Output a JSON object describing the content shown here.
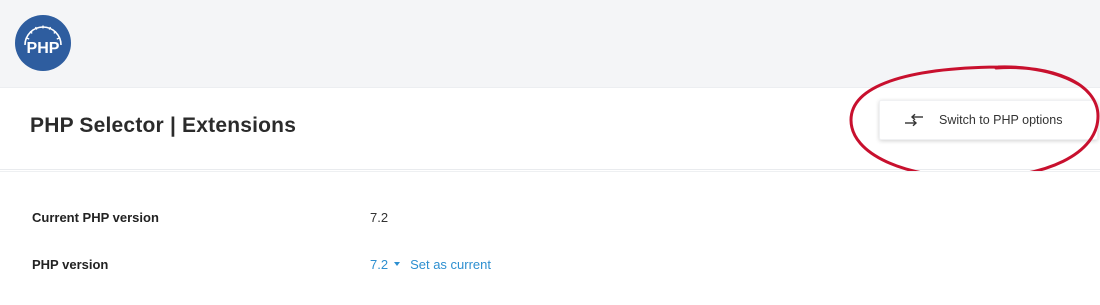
{
  "brand": {
    "logo_text": "PHP",
    "logo_color": "#2e5d9f"
  },
  "header": {
    "title": "PHP Selector | Extensions",
    "switch_button_label": "Switch to PHP options",
    "switch_button_icon": "switch-arrows-icon"
  },
  "annotation": {
    "shape": "ellipse",
    "color": "#c8102e",
    "target": "switch-to-php-options-button"
  },
  "details": {
    "current_version_label": "Current PHP version",
    "current_version_value": "7.2",
    "version_label": "PHP version",
    "version_selected": "7.2",
    "set_current_link": "Set as current"
  },
  "colors": {
    "link": "#2d8fd0",
    "topbar_bg": "#f4f5f7"
  }
}
